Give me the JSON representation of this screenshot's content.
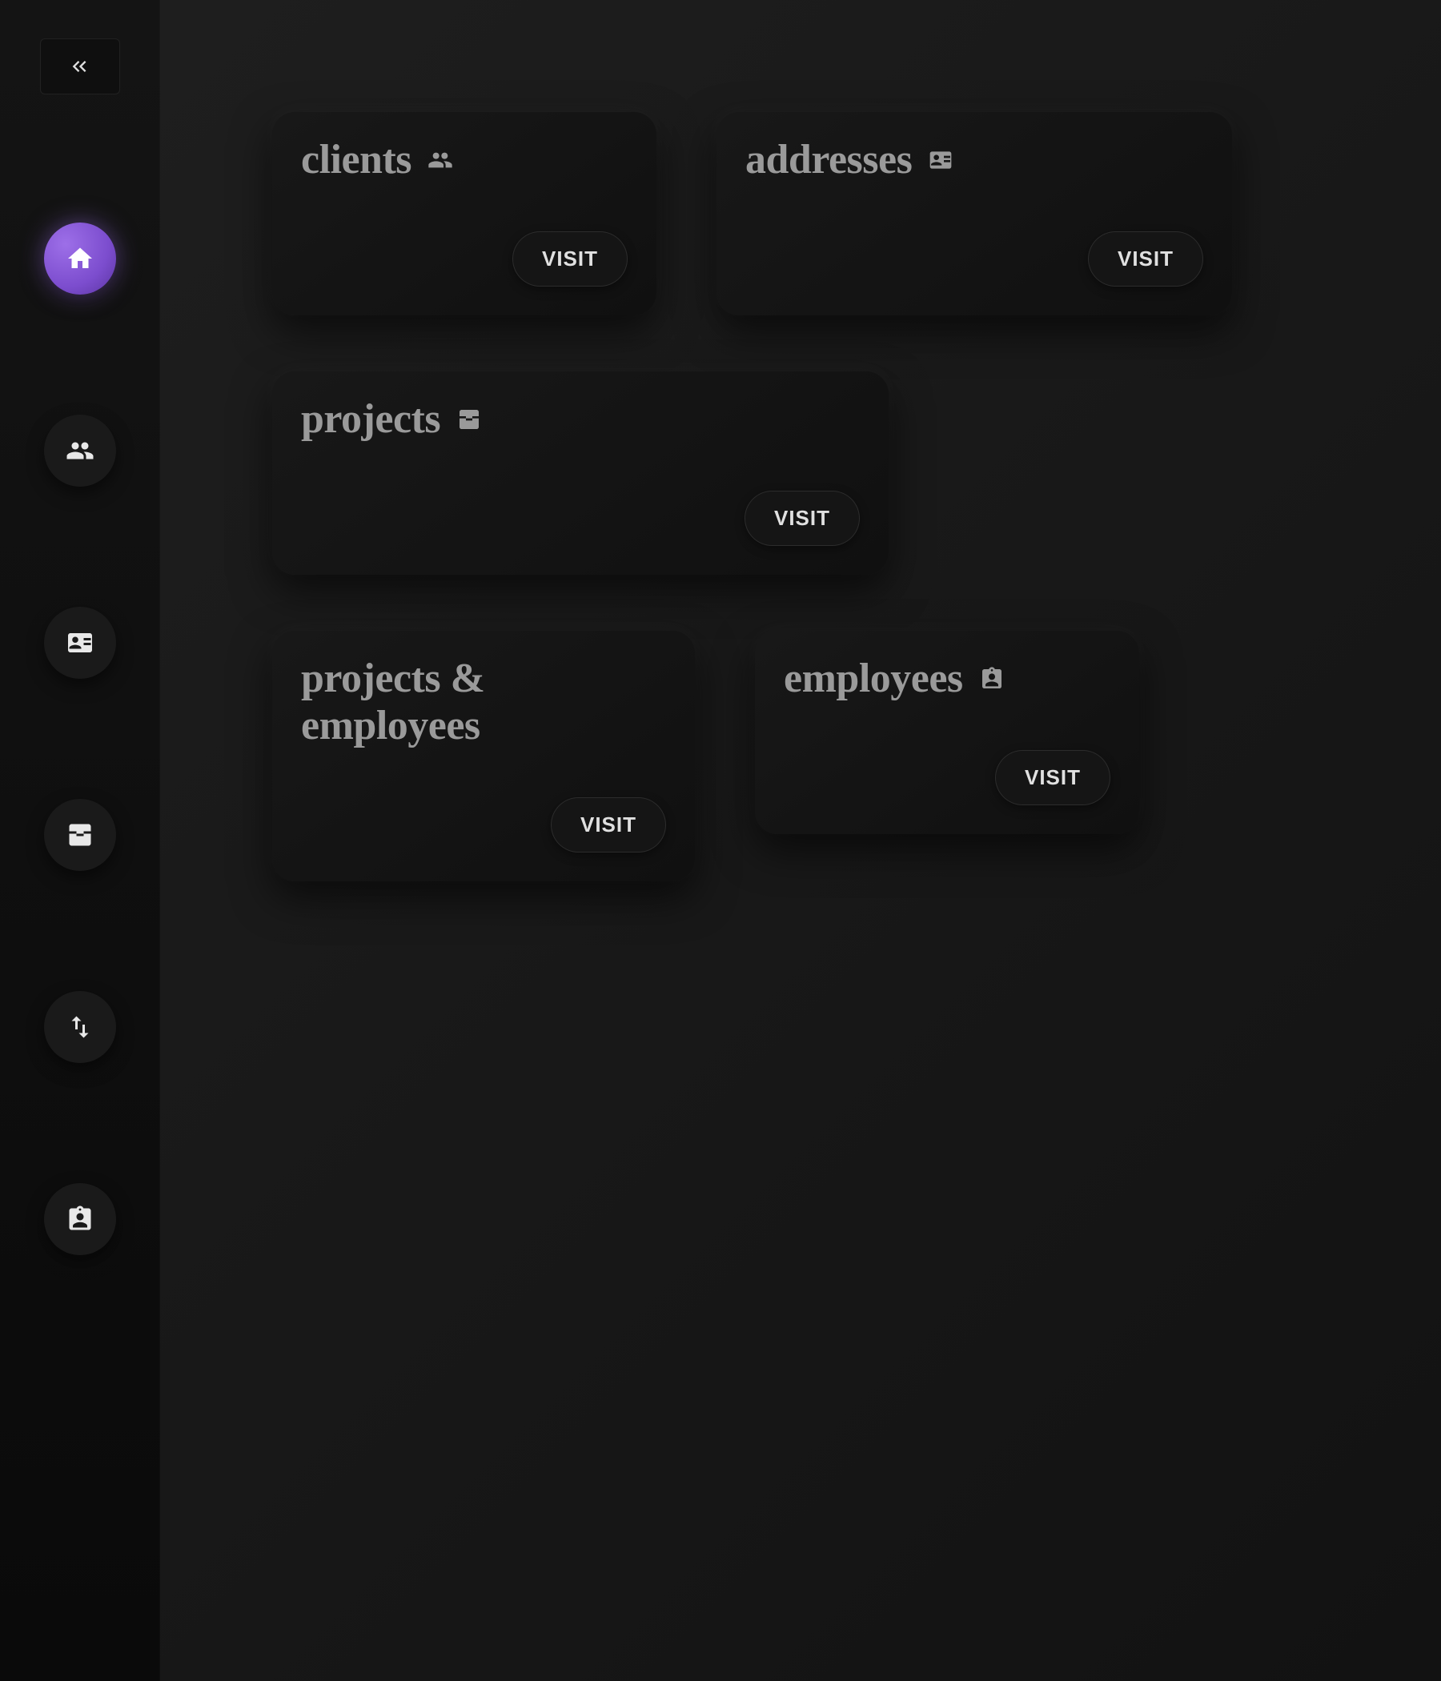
{
  "sidebar": {
    "items": [
      {
        "id": "home",
        "icon": "home-icon",
        "active": true
      },
      {
        "id": "clients",
        "icon": "people-icon",
        "active": false
      },
      {
        "id": "addresses",
        "icon": "address-card-icon",
        "active": false
      },
      {
        "id": "projects",
        "icon": "inbox-stack-icon",
        "active": false
      },
      {
        "id": "projects-employees",
        "icon": "swap-icon",
        "active": false
      },
      {
        "id": "employees",
        "icon": "person-badge-icon",
        "active": false
      }
    ]
  },
  "cards": {
    "clients": {
      "title": "clients",
      "action": "VISIT",
      "icon": "people-icon"
    },
    "addresses": {
      "title": "addresses",
      "action": "VISIT",
      "icon": "address-card-icon"
    },
    "projects": {
      "title": "projects",
      "action": "VISIT",
      "icon": "inbox-stack-icon"
    },
    "projects_employees": {
      "title": "projects & employees",
      "action": "VISIT"
    },
    "employees": {
      "title": "employees",
      "action": "VISIT",
      "icon": "person-badge-icon"
    }
  },
  "colors": {
    "accent": "#7c4dce",
    "text_muted": "#9a9a9a",
    "text_bright": "#e0e0e0"
  }
}
